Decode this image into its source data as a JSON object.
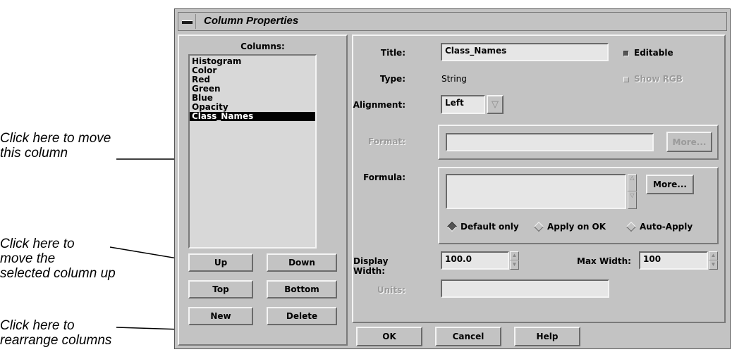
{
  "annotations": {
    "move_column": "Click here to move\nthis column",
    "move_up": "Click here to\nmove the\nselected column up",
    "rearrange": "Click here to\nrearrange columns"
  },
  "window": {
    "title": "Column Properties"
  },
  "columns_panel": {
    "heading": "Columns:",
    "items": [
      {
        "label": "Histogram",
        "selected": false
      },
      {
        "label": "Color",
        "selected": false
      },
      {
        "label": "Red",
        "selected": false
      },
      {
        "label": "Green",
        "selected": false
      },
      {
        "label": "Blue",
        "selected": false
      },
      {
        "label": "Opacity",
        "selected": false
      },
      {
        "label": "Class_Names",
        "selected": true
      }
    ],
    "buttons": {
      "up": "Up",
      "down": "Down",
      "top": "Top",
      "bottom": "Bottom",
      "new": "New",
      "delete": "Delete"
    }
  },
  "properties": {
    "title_label": "Title:",
    "title_value": "Class_Names",
    "editable_label": "Editable",
    "editable_checked": true,
    "type_label": "Type:",
    "type_value": "String",
    "show_rgb_label": "Show RGB",
    "alignment_label": "Alignment:",
    "alignment_value": "Left",
    "format_label": "Format:",
    "format_value": "",
    "format_more": "More...",
    "formula_label": "Formula:",
    "formula_value": "",
    "formula_more": "More...",
    "apply_options": [
      {
        "label": "Default only",
        "selected": true
      },
      {
        "label": "Apply on OK",
        "selected": false
      },
      {
        "label": "Auto-Apply",
        "selected": false
      }
    ],
    "display_width_label": "Display Width:",
    "display_width_value": "100.0",
    "max_width_label": "Max Width:",
    "max_width_value": "100",
    "units_label": "Units:",
    "units_value": ""
  },
  "footer": {
    "ok": "OK",
    "cancel": "Cancel",
    "help": "Help"
  },
  "colors": {
    "window_bg": "#c3c3c3",
    "selection_bg": "#000000"
  }
}
